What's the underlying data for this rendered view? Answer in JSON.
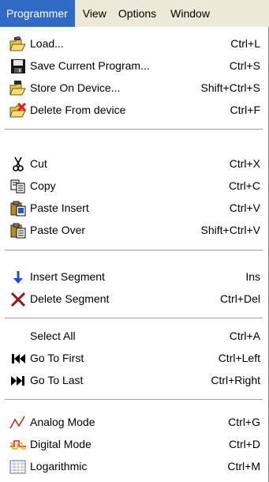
{
  "menubar": {
    "items": [
      "Programmer",
      "View",
      "Options",
      "Window"
    ]
  },
  "menu": {
    "groups": [
      [
        {
          "label": "Load...",
          "shortcut": "Ctrl+L",
          "icon": "load-folder-icon"
        },
        {
          "label": "Save Current Program...",
          "shortcut": "Ctrl+S",
          "icon": "save-disk-icon"
        },
        {
          "label": "Store On Device...",
          "shortcut": "Shift+Ctrl+S",
          "icon": "store-device-icon"
        },
        {
          "label": "Delete From device",
          "shortcut": "Ctrl+F",
          "icon": "delete-device-icon"
        }
      ],
      [
        {
          "label": "Cut",
          "shortcut": "Ctrl+X",
          "icon": "cut-icon"
        },
        {
          "label": "Copy",
          "shortcut": "Ctrl+C",
          "icon": "copy-icon"
        },
        {
          "label": "Paste Insert",
          "shortcut": "Ctrl+V",
          "icon": "paste-insert-icon"
        },
        {
          "label": "Paste Over",
          "shortcut": "Shift+Ctrl+V",
          "icon": "paste-over-icon"
        }
      ],
      [
        {
          "label": "Insert Segment",
          "shortcut": "Ins",
          "icon": "insert-arrow-icon"
        },
        {
          "label": "Delete Segment",
          "shortcut": "Ctrl+Del",
          "icon": "delete-x-icon"
        }
      ],
      [
        {
          "label": "Select All",
          "shortcut": "Ctrl+A",
          "icon": ""
        },
        {
          "label": "Go To First",
          "shortcut": "Ctrl+Left",
          "icon": "go-first-icon"
        },
        {
          "label": "Go To Last",
          "shortcut": "Ctrl+Right",
          "icon": "go-last-icon"
        }
      ],
      [
        {
          "label": "Analog Mode",
          "shortcut": "Ctrl+G",
          "icon": "analog-wave-icon"
        },
        {
          "label": "Digital Mode",
          "shortcut": "Ctrl+D",
          "icon": "digital-wave-icon"
        },
        {
          "label": "Logarithmic",
          "shortcut": "Ctrl+M",
          "icon": "log-grid-icon"
        }
      ]
    ]
  },
  "colors": {
    "highlight": "#316ac5",
    "menubar_bg": "#ece9d8"
  }
}
